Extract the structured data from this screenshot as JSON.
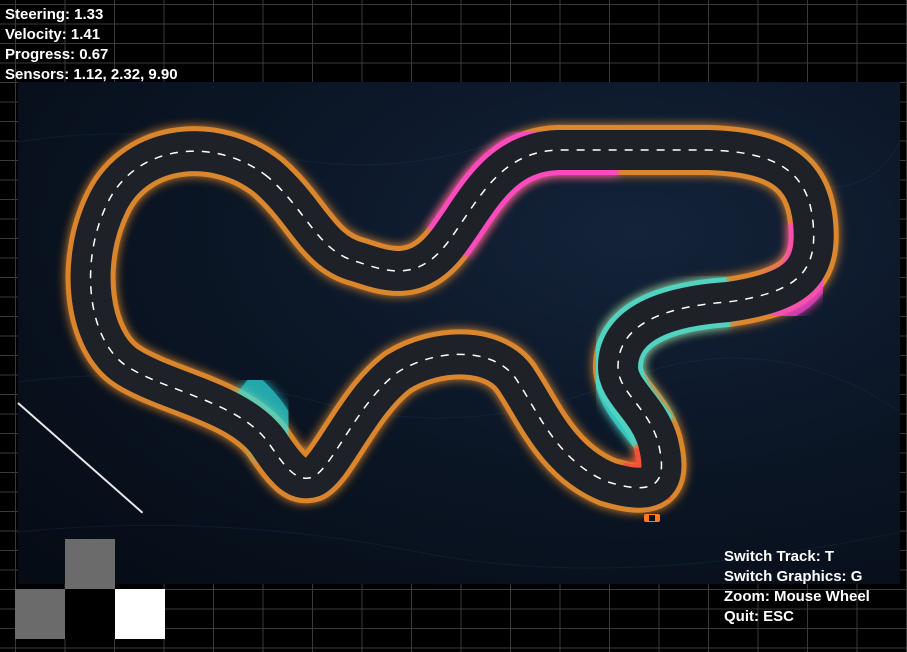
{
  "hud": {
    "steering": "Steering: 1.33",
    "velocity": "Velocity: 1.41",
    "progress": "Progress: 0.67",
    "sensors": "Sensors: 1.12, 2.32, 9.90"
  },
  "controls_help": {
    "switch_track": "Switch Track: T",
    "switch_graphics": "Switch Graphics: G",
    "zoom": "Zoom: Mouse Wheel",
    "quit": "Quit: ESC"
  },
  "action_pads": {
    "up": "#6b6b6b",
    "left": "#6b6b6b",
    "down": "#000000",
    "right": "#ffffff"
  },
  "colors": {
    "orange_glow": "#ff9a2e",
    "pink_glow": "#ff3fd8",
    "cyan_glow": "#2fe6e6",
    "red_glow": "#ff3a3a",
    "asphalt": "#1e2228",
    "hud_text": "#ffffff"
  }
}
